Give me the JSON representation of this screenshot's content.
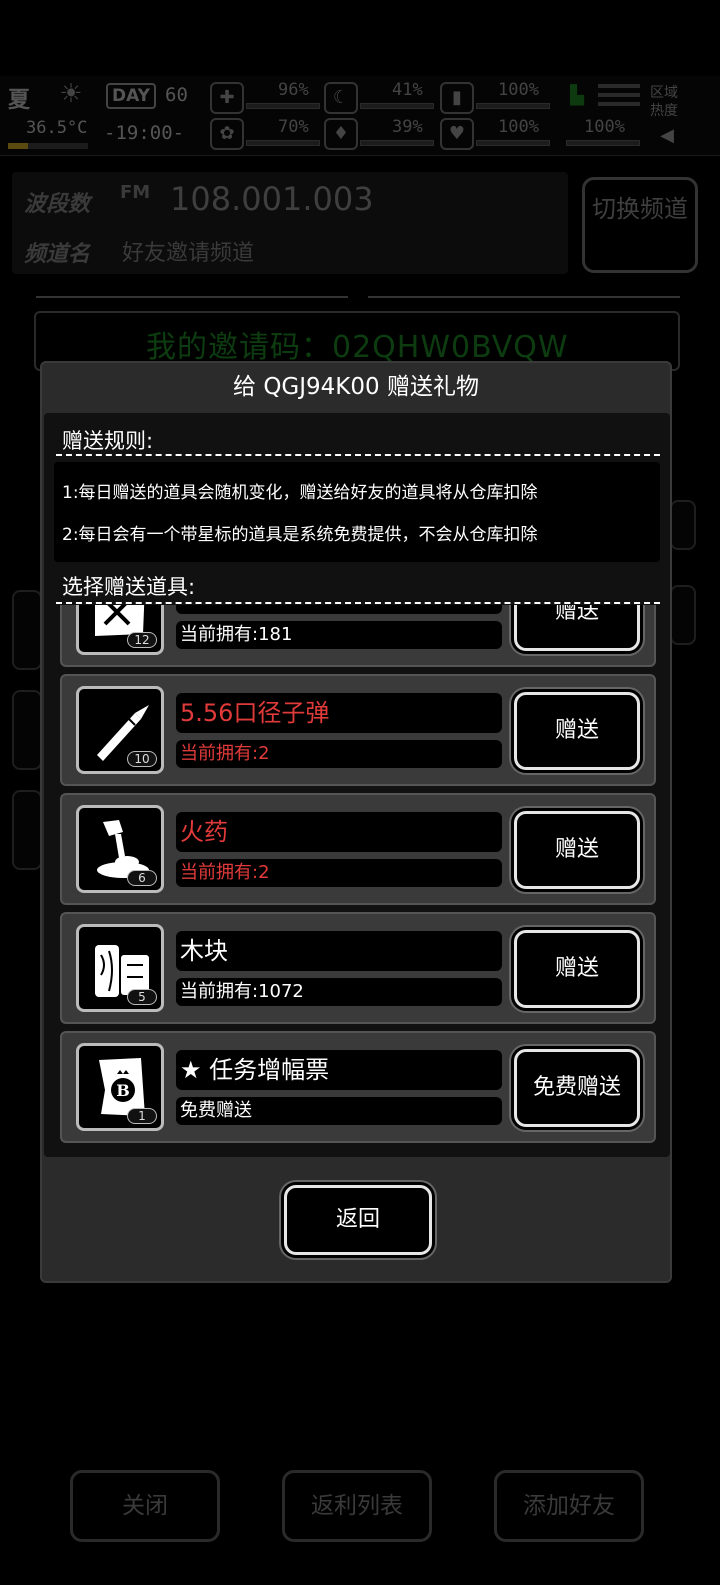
{
  "status": {
    "season": "夏",
    "temperature": "36.5°C",
    "day_label": "DAY",
    "day_number": "60",
    "time": "-19:00-",
    "stats": [
      "96%",
      "41%",
      "100%",
      "70%",
      "39%",
      "100%",
      "100%"
    ],
    "region_label": "区域热度"
  },
  "radio": {
    "band_label": "波段数",
    "fm": "FM",
    "frequency": "108.001.003",
    "channel_label": "频道名",
    "channel_name": "好友邀请频道",
    "switch_button": "切换频道",
    "invite_code": "我的邀请码：02QHW0BVQW"
  },
  "bottom_buttons": {
    "close": "关闭",
    "rebate": "返利列表",
    "add_friend": "添加好友"
  },
  "dialog": {
    "title": "给 QGJ94K00 赠送礼物",
    "rules_title": "赠送规则:",
    "rule_1": "1:每日赠送的道具会随机变化，赠送给好友的道具将从仓库扣除",
    "rule_2": "2:每日会有一个带星标的道具是系统免费提供，不会从仓库扣除",
    "select_title": "选择赠送道具:",
    "back_button": "返回",
    "items": [
      {
        "name": "",
        "owned": "当前拥有:181",
        "count": "12",
        "button": "赠送",
        "icon": "paper-icon",
        "color": "#ffffff"
      },
      {
        "name": "5.56口径子弹",
        "owned": "当前拥有:2",
        "count": "10",
        "button": "赠送",
        "icon": "bullet-icon",
        "color": "#e03a3a"
      },
      {
        "name": "火药",
        "owned": "当前拥有:2",
        "count": "6",
        "button": "赠送",
        "icon": "gunpowder-icon",
        "color": "#e03a3a"
      },
      {
        "name": "木块",
        "owned": "当前拥有:1072",
        "count": "5",
        "button": "赠送",
        "icon": "wood-icon",
        "color": "#ffffff"
      },
      {
        "name": "★ 任务增幅票",
        "owned": "免费赠送",
        "count": "1",
        "button": "免费赠送",
        "icon": "ticket-icon",
        "color": "#ffffff"
      }
    ]
  }
}
